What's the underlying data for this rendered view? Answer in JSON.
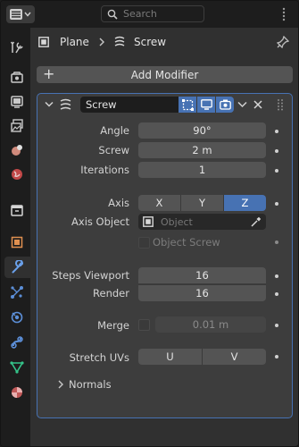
{
  "search": {
    "placeholder": "Search"
  },
  "breadcrumb": {
    "object": "Plane",
    "modifier": "Screw"
  },
  "add_modifier": {
    "label": "Add Modifier"
  },
  "modifier": {
    "name": "Screw",
    "angle": {
      "label": "Angle",
      "value": "90°"
    },
    "screw": {
      "label": "Screw",
      "value": "2 m"
    },
    "iterations": {
      "label": "Iterations",
      "value": "1"
    },
    "axis": {
      "label": "Axis",
      "options": [
        "X",
        "Y",
        "Z"
      ],
      "selected": "Z"
    },
    "axis_object": {
      "label": "Axis Object",
      "placeholder": "Object"
    },
    "object_screw": {
      "label": "Object Screw",
      "checked": false
    },
    "steps_viewport": {
      "label": "Steps Viewport",
      "value": "16"
    },
    "render": {
      "label": "Render",
      "value": "16"
    },
    "merge": {
      "label": "Merge",
      "checked": false,
      "value": "0.01 m"
    },
    "stretch_uvs": {
      "label": "Stretch UVs",
      "options": [
        "U",
        "V"
      ]
    },
    "normals": {
      "label": "Normals",
      "expanded": false
    }
  },
  "tabs": [
    "tool",
    "render",
    "output",
    "view-layer",
    "scene",
    "world",
    "collection",
    "object",
    "modifiers",
    "particles",
    "physics",
    "constraints",
    "data",
    "material"
  ],
  "active_tab": "modifiers",
  "colors": {
    "accent": "#4772b3",
    "panel": "#3d3d3d",
    "field": "#545454",
    "background": "#303030"
  }
}
